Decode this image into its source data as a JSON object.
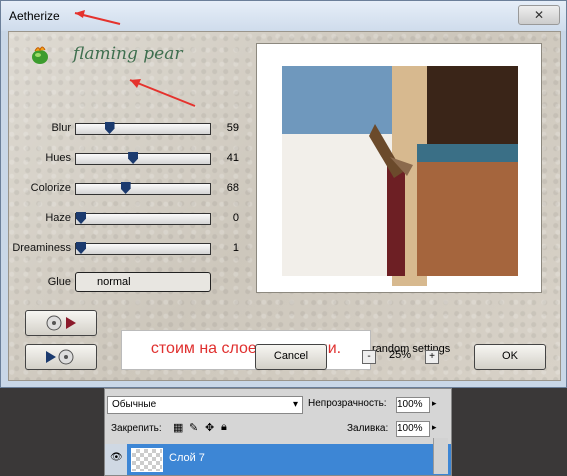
{
  "window": {
    "title": "Aetherize",
    "close_label": "✕"
  },
  "brand": {
    "name": "flaming pear"
  },
  "sliders": [
    {
      "label": "Blur",
      "value": "59"
    },
    {
      "label": "Hues",
      "value": "41"
    },
    {
      "label": "Colorize",
      "value": "68"
    },
    {
      "label": "Haze",
      "value": "0"
    },
    {
      "label": "Dreaminess",
      "value": "1"
    }
  ],
  "slider_levels": [
    0.23,
    0.42,
    0.36,
    0.0,
    0.0
  ],
  "glue": {
    "label": "Glue",
    "value": "normal"
  },
  "callout": {
    "text": "стоим на слое с птицами."
  },
  "random_settings": "random settings",
  "buttons": {
    "cancel": "Cancel",
    "ok": "OK"
  },
  "zoom": {
    "minus": "-",
    "value": "25%",
    "plus": "+"
  },
  "layers_panel": {
    "blend_mode": "Обычные",
    "opacity_label": "Непрозрачность:",
    "opacity_value": "100%",
    "lock_label": "Закрепить:",
    "fill_label": "Заливка:",
    "fill_value": "100%",
    "layer_name": "Слой 7"
  },
  "colors": {
    "accent": "#e5322d",
    "layer_highlight": "#3d86d5",
    "slider_thumb": "#1b3a6e"
  }
}
